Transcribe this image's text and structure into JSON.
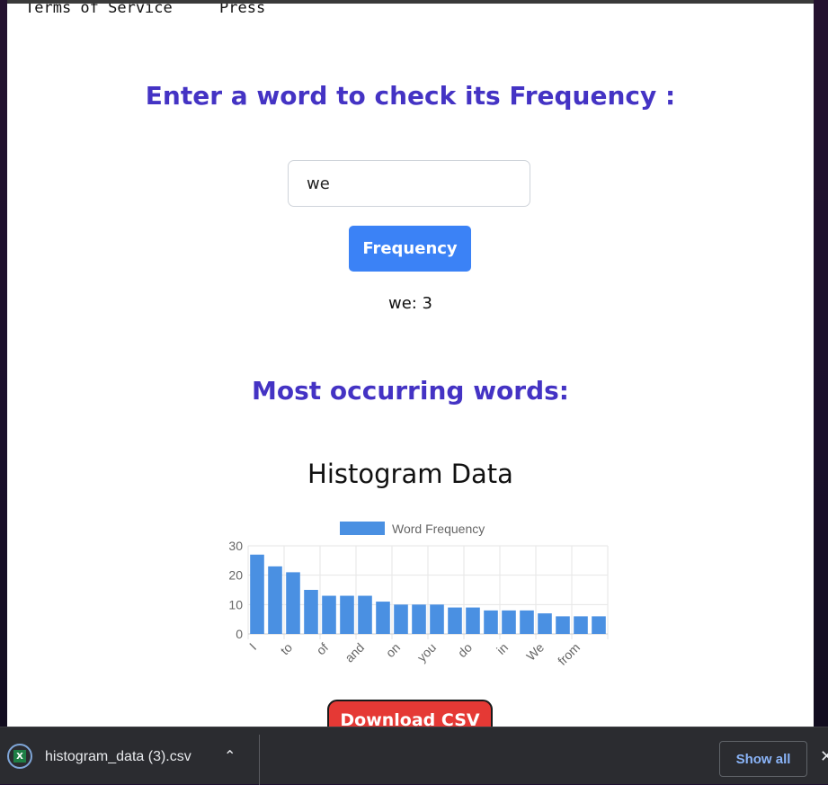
{
  "top_links": [
    "Terms of Service",
    "Press"
  ],
  "search": {
    "heading": "Enter a word to check its Frequency :",
    "input_value": "we",
    "button_label": "Frequency",
    "result": "we: 3"
  },
  "most_heading": "Most occurring words:",
  "histogram_title": "Histogram Data",
  "chart_data": {
    "type": "bar",
    "categories": [
      "I",
      "",
      "to",
      "",
      "of",
      "",
      "and",
      "",
      "on",
      "",
      "you",
      "",
      "do",
      "",
      "in",
      "",
      "We",
      "",
      "from",
      ""
    ],
    "tick_labels_shown": [
      "I",
      "to",
      "of",
      "and",
      "on",
      "you",
      "do",
      "in",
      "We",
      "from"
    ],
    "series": [
      {
        "name": "Word Frequency",
        "values": [
          27,
          23,
          21,
          15,
          13,
          13,
          13,
          11,
          10,
          10,
          10,
          9,
          9,
          8,
          8,
          8,
          7,
          6,
          6,
          6
        ]
      }
    ],
    "ylim": [
      0,
      30
    ],
    "yticks": [
      0,
      10,
      20,
      30
    ],
    "legend_position": "top",
    "grid": true,
    "bar_color": "#4a90e2"
  },
  "download_button_label": "Download CSV",
  "download_bar": {
    "filename": "histogram_data (3).csv",
    "show_all_label": "Show all",
    "file_icon": "excel-icon",
    "chevron": "chevron-up-icon",
    "close": "close-icon"
  }
}
